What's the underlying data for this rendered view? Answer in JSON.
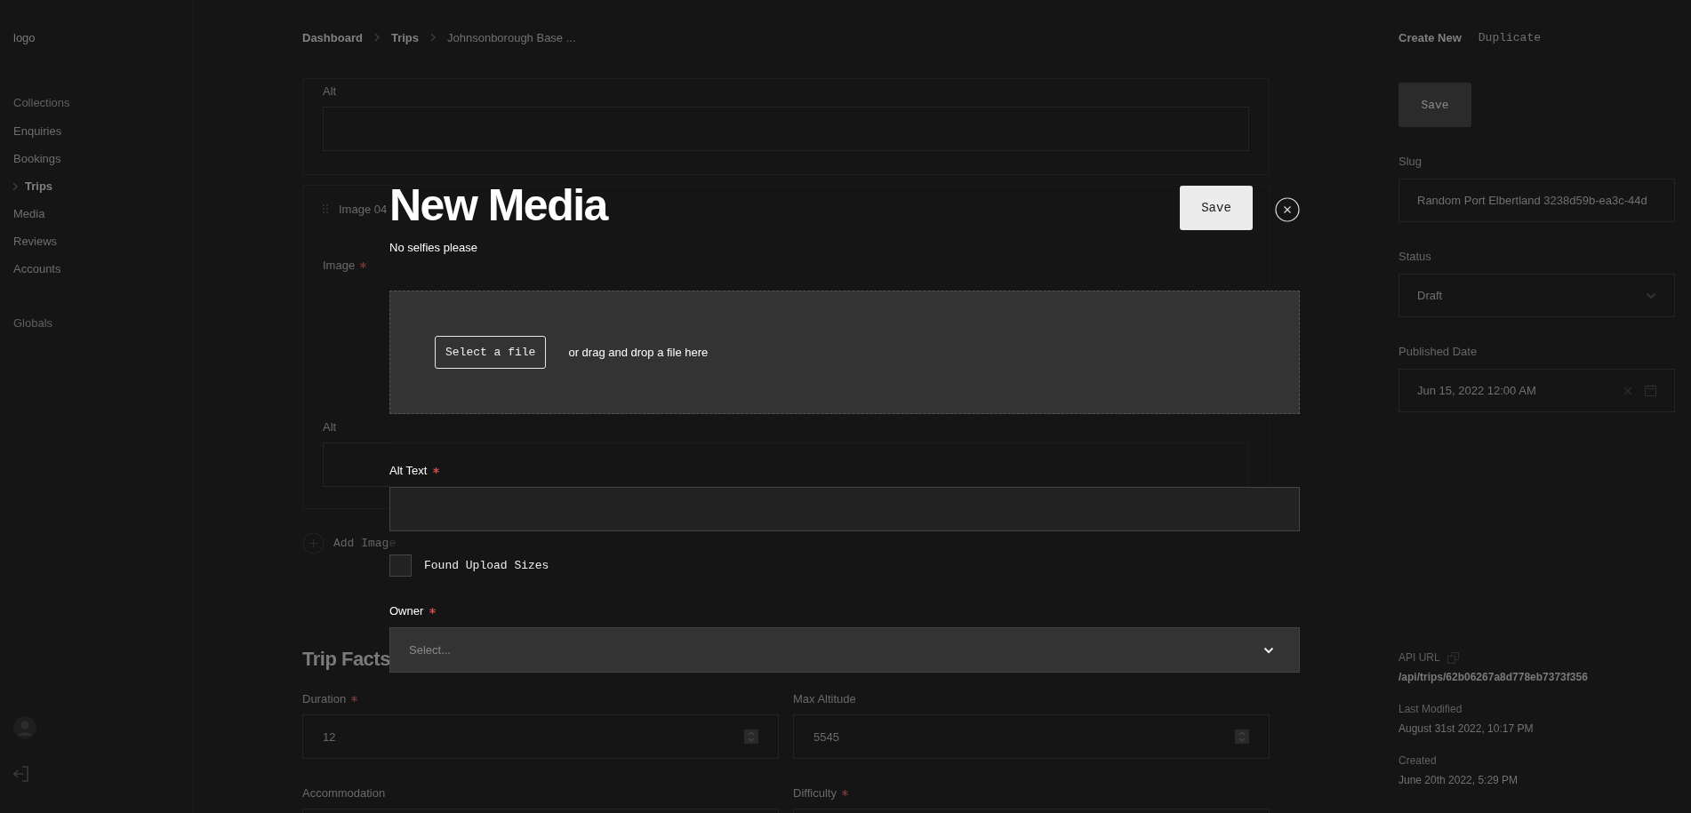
{
  "sidebar": {
    "logo": "logo",
    "sections": [
      {
        "title": "Collections",
        "items": [
          {
            "label": "Enquiries",
            "selected": false
          },
          {
            "label": "Bookings",
            "selected": false
          },
          {
            "label": "Trips",
            "selected": true
          },
          {
            "label": "Media",
            "selected": false
          },
          {
            "label": "Reviews",
            "selected": false
          },
          {
            "label": "Accounts",
            "selected": false
          }
        ]
      },
      {
        "title": "Globals"
      }
    ]
  },
  "breadcrumbs": [
    "Dashboard",
    "Trips",
    "Johnsonborough Base ..."
  ],
  "blocks": [
    {
      "fields": [
        {
          "label": "Alt",
          "required": false
        }
      ]
    },
    {
      "title": "Image 04",
      "fields": [
        {
          "label": "Image",
          "required": true,
          "kind": "upload"
        },
        {
          "label": "Alt",
          "required": false
        }
      ]
    }
  ],
  "add_button": "Add Image",
  "section_title": "Trip Facts",
  "fields": [
    {
      "label": "Duration",
      "required": true,
      "value": "12",
      "kind": "number"
    },
    {
      "label": "Max Altitude",
      "required": false,
      "value": "5545",
      "kind": "number"
    },
    {
      "label": "Accommodation",
      "required": false
    },
    {
      "label": "Difficulty",
      "required": true
    }
  ],
  "right_panel": {
    "create_new": "Create New",
    "duplicate": "Duplicate",
    "save": "Save",
    "fields": [
      {
        "label": "Slug",
        "value": "Random Port Elbertland 3238d59b-ea3c-44d",
        "kind": "text"
      },
      {
        "label": "Status",
        "value": "Draft",
        "kind": "select"
      },
      {
        "label": "Published Date",
        "value": "Jun 15, 2022 12:00 AM",
        "kind": "date"
      }
    ],
    "meta": [
      {
        "label": "API URL",
        "value": "/api/trips/62b06267a8d778eb7373f356",
        "kind": "link"
      },
      {
        "label": "Last Modified",
        "value": "August 31st 2022, 10:17 PM",
        "kind": "text"
      },
      {
        "label": "Created",
        "value": "June 20th 2022, 5:29 PM",
        "kind": "text"
      }
    ]
  },
  "modal": {
    "title": "New Media",
    "description": "No selfies please",
    "save": "Save",
    "upload": {
      "button": "Select a file",
      "hint": "or drag and drop a file here"
    },
    "fields": [
      {
        "kind": "text",
        "label": "Alt Text",
        "required": true
      },
      {
        "kind": "checkbox",
        "label": "Found Upload Sizes",
        "checked": false
      },
      {
        "kind": "select",
        "label": "Owner",
        "required": true,
        "placeholder": "Select..."
      }
    ]
  }
}
